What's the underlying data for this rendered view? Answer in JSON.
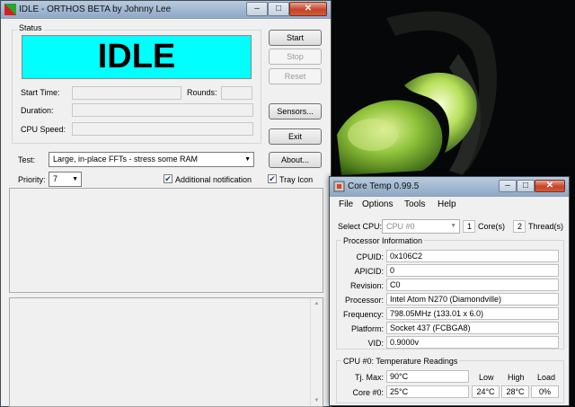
{
  "orthos": {
    "title": "IDLE - ORTHOS BETA by Johnny Lee",
    "status_group": "Status",
    "status_banner": "IDLE",
    "start_time_label": "Start Time:",
    "rounds_label": "Rounds:",
    "duration_label": "Duration:",
    "cpu_speed_label": "CPU Speed:",
    "buttons": {
      "start": "Start",
      "stop": "Stop",
      "reset": "Reset",
      "sensors": "Sensors...",
      "exit": "Exit",
      "about": "About..."
    },
    "test_label": "Test:",
    "test_value": "Large, in-place FFTs - stress some RAM",
    "priority_label": "Priority:",
    "priority_value": "7",
    "additional_notification": "Additional notification",
    "additional_notification_checked": true,
    "tray_icon": "Tray Icon",
    "tray_icon_checked": true,
    "banner_color": "#00ffff"
  },
  "coretemp": {
    "title": "Core Temp 0.99.5",
    "menu": [
      "File",
      "Options",
      "Tools",
      "Help"
    ],
    "select_cpu_label": "Select CPU:",
    "select_cpu_value": "CPU #0",
    "cores_count": "1",
    "cores_label": "Core(s)",
    "threads_count": "2",
    "threads_label": "Thread(s)",
    "processor_info_header": "Processor Information",
    "info": [
      {
        "label": "CPUID:",
        "value": "0x106C2"
      },
      {
        "label": "APICID:",
        "value": "0"
      },
      {
        "label": "Revision:",
        "value": "C0"
      },
      {
        "label": "Processor:",
        "value": "Intel Atom N270 (Diamondville)"
      },
      {
        "label": "Frequency:",
        "value": "798.05MHz (133.01 x 6.0)"
      },
      {
        "label": "Platform:",
        "value": "Socket 437 (FCBGA8)"
      },
      {
        "label": "VID:",
        "value": "0.9000v"
      }
    ],
    "temp_header": "CPU #0: Temperature Readings",
    "tj_max_label": "Tj. Max:",
    "tj_max_value": "90°C",
    "col_low": "Low",
    "col_high": "High",
    "col_load": "Load",
    "core0_label": "Core #0:",
    "core0_temp": "25°C",
    "core0_low": "24°C",
    "core0_high": "28°C",
    "core0_load": "0%"
  }
}
